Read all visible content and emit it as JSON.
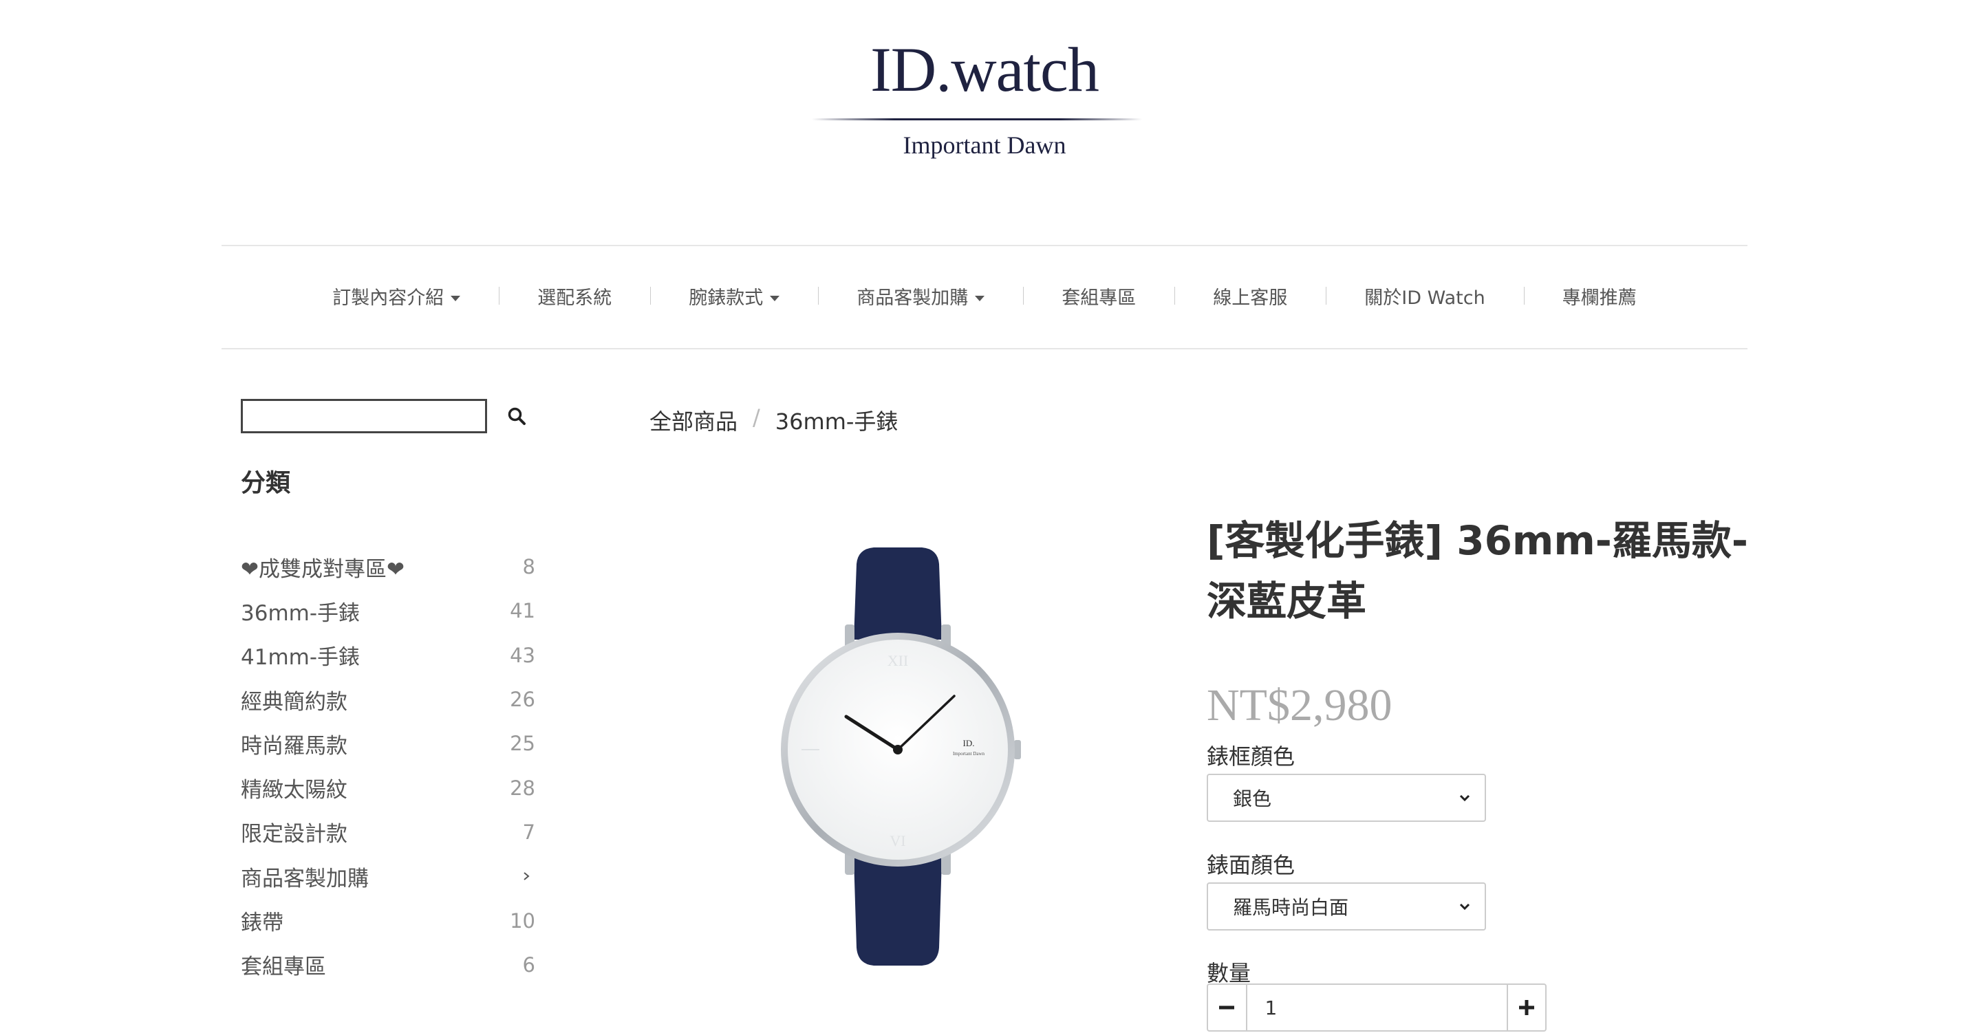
{
  "header": {
    "logo": "ID.watch",
    "tagline": "Important Dawn"
  },
  "nav": {
    "items": [
      {
        "label": "訂製內容介紹",
        "dropdown": true
      },
      {
        "label": "選配系統",
        "dropdown": false
      },
      {
        "label": "腕錶款式",
        "dropdown": true
      },
      {
        "label": "商品客製加購",
        "dropdown": true
      },
      {
        "label": "套組專區",
        "dropdown": false
      },
      {
        "label": "線上客服",
        "dropdown": false
      },
      {
        "label": "關於ID Watch",
        "dropdown": false
      },
      {
        "label": "專欄推薦",
        "dropdown": false
      }
    ]
  },
  "sidebar": {
    "search_value": "",
    "search_icon": "search-icon",
    "title": "分類",
    "categories": [
      {
        "label": "❤成雙成對專區❤",
        "count": "8"
      },
      {
        "label": "36mm-手錶",
        "count": "41"
      },
      {
        "label": "41mm-手錶",
        "count": "43"
      },
      {
        "label": "經典簡約款",
        "count": "26"
      },
      {
        "label": "時尚羅馬款",
        "count": "25"
      },
      {
        "label": "精緻太陽紋",
        "count": "28"
      },
      {
        "label": "限定設計款",
        "count": "7"
      },
      {
        "label": "商品客製加購",
        "count": ""
      },
      {
        "label": "錶帶",
        "count": "10"
      },
      {
        "label": "套組專區",
        "count": "6"
      }
    ]
  },
  "breadcrumb": {
    "root": "全部商品",
    "separator": "/",
    "current": "36mm-手錶"
  },
  "product": {
    "title": "[客製化手錶] 36mm-羅馬款-深藍皮革",
    "price": "NT$2,980",
    "dial_logo": "ID.",
    "dial_brand": "Important Dawn",
    "strap_color": "#1f2a52",
    "case_color": "#c9cdd2",
    "frame_label": "錶框顏色",
    "frame_value": "銀色",
    "face_label": "錶面顏色",
    "face_value": "羅馬時尚白面",
    "qty_label": "數量",
    "qty_value": "1"
  }
}
